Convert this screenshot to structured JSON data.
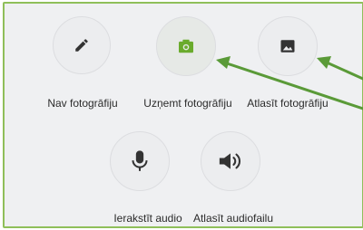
{
  "options": {
    "row1": [
      {
        "label": "Nav fotogrāfiju",
        "icon": "pencil-icon"
      },
      {
        "label": "Uzņemt fotogrāfiju",
        "icon": "camera-icon"
      },
      {
        "label": "Atlasīt fotogrāfiju",
        "icon": "image-icon"
      }
    ],
    "row2": [
      {
        "label": "Ierakstīt audio",
        "icon": "microphone-icon"
      },
      {
        "label": "Atlasīt audiofailu",
        "icon": "speaker-icon"
      }
    ]
  },
  "colors": {
    "border": "#8fbf5a",
    "camera_accent": "#6aab2c",
    "arrow": "#5a9a38",
    "icon_dark": "#333333"
  }
}
